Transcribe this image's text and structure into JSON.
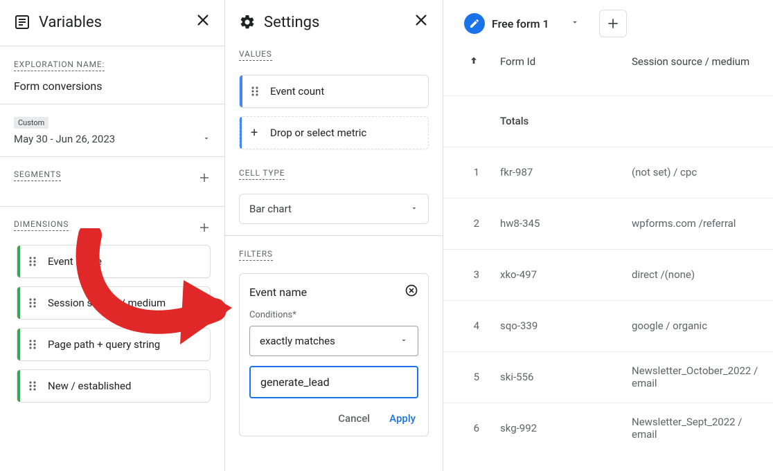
{
  "variables": {
    "title": "Variables",
    "exploration_label": "EXPLORATION NAME:",
    "exploration_name": "Form conversions",
    "date_custom_badge": "Custom",
    "date_range": "May 30 - Jun 26, 2023",
    "segments_label": "SEGMENTS",
    "dimensions_label": "DIMENSIONS",
    "dimension_chips": [
      "Event name",
      "Session source / medium",
      "Page path + query string",
      "New / established"
    ]
  },
  "settings": {
    "title": "Settings",
    "values_label": "VALUES",
    "value_chip": "Event count",
    "drop_metric_label": "Drop or select metric",
    "cell_type_label": "CELL TYPE",
    "cell_type_value": "Bar chart",
    "filters_label": "FILTERS",
    "filter": {
      "dimension": "Event name",
      "conditions_label": "Conditions*",
      "matcher": "exactly matches",
      "value": "generate_lead",
      "cancel": "Cancel",
      "apply": "Apply"
    }
  },
  "report": {
    "tab_name": "Free form 1",
    "columns": {
      "form_id": "Form Id",
      "source_medium": "Session source / medium"
    },
    "totals_label": "Totals",
    "rows": [
      {
        "idx": "1",
        "form_id": "fkr-987",
        "sm": "(not set) / cpc"
      },
      {
        "idx": "2",
        "form_id": "hw8-345",
        "sm": "wpforms.com /referral"
      },
      {
        "idx": "3",
        "form_id": "xko-497",
        "sm": "direct /(none)"
      },
      {
        "idx": "4",
        "form_id": "sqo-339",
        "sm": "google / organic"
      },
      {
        "idx": "5",
        "form_id": "ski-556",
        "sm": "Newsletter_October_2022 / email"
      },
      {
        "idx": "6",
        "form_id": "skg-992",
        "sm": "Newsletter_Sept_2022 / email"
      }
    ]
  }
}
